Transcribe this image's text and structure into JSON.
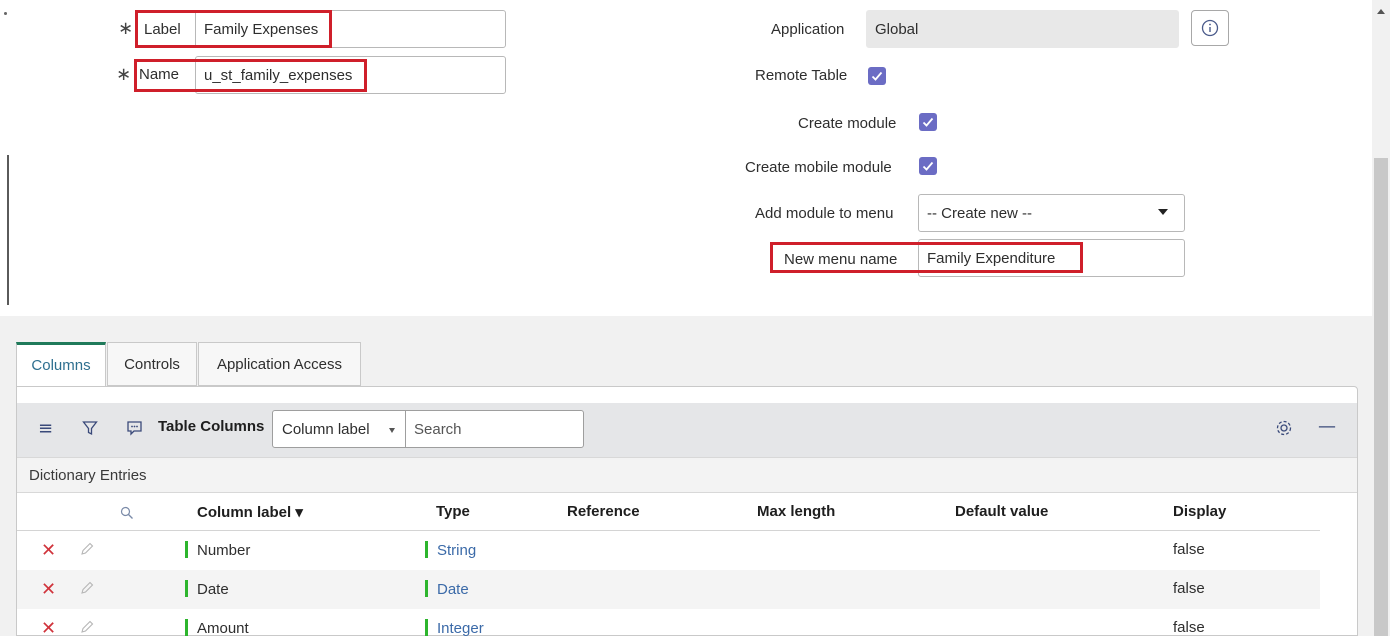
{
  "form": {
    "label": {
      "title": "Label",
      "value": "Family Expenses"
    },
    "name": {
      "title": "Name",
      "value": "u_st_family_expenses"
    },
    "application": {
      "title": "Application",
      "value": "Global"
    },
    "remote_table": {
      "title": "Remote Table",
      "checked": true
    },
    "create_module": {
      "title": "Create module",
      "checked": true
    },
    "create_mobile_module": {
      "title": "Create mobile module",
      "checked": true
    },
    "add_module_to_menu": {
      "title": "Add module to menu",
      "value": "-- Create new --"
    },
    "new_menu_name": {
      "title": "New menu name",
      "value": "Family Expenditure"
    },
    "required_mark": "∗"
  },
  "tabs": [
    {
      "label": "Columns",
      "active": true
    },
    {
      "label": "Controls",
      "active": false
    },
    {
      "label": "Application Access",
      "active": false
    }
  ],
  "list": {
    "title": "Table Columns",
    "filter_field": "Column label",
    "search_placeholder": "Search",
    "section_label": "Dictionary Entries",
    "columns": [
      "Column label ▾",
      "Type",
      "Reference",
      "Max length",
      "Default value",
      "Display"
    ],
    "rows": [
      {
        "label": "Number",
        "type": "String",
        "display": "false"
      },
      {
        "label": "Date",
        "type": "Date",
        "display": "false"
      },
      {
        "label": "Amount",
        "type": "Integer",
        "display": "false"
      }
    ]
  },
  "colors": {
    "highlight": "#cf1f2a",
    "checkbox": "#6b6cc4",
    "active_tab": "#1f7a5a",
    "link": "#3b6aa8",
    "field_indicator": "#2db52d",
    "delete": "#d0333b"
  },
  "icons": {
    "menu": "hamburger-menu-icon",
    "filter": "funnel-filter-icon",
    "chat": "chat-bubble-icon",
    "settings": "gear-icon",
    "collapse": "minus-icon",
    "info": "info-circle-icon",
    "search": "magnifier-icon",
    "delete": "x-icon",
    "edit": "pencil-icon"
  }
}
